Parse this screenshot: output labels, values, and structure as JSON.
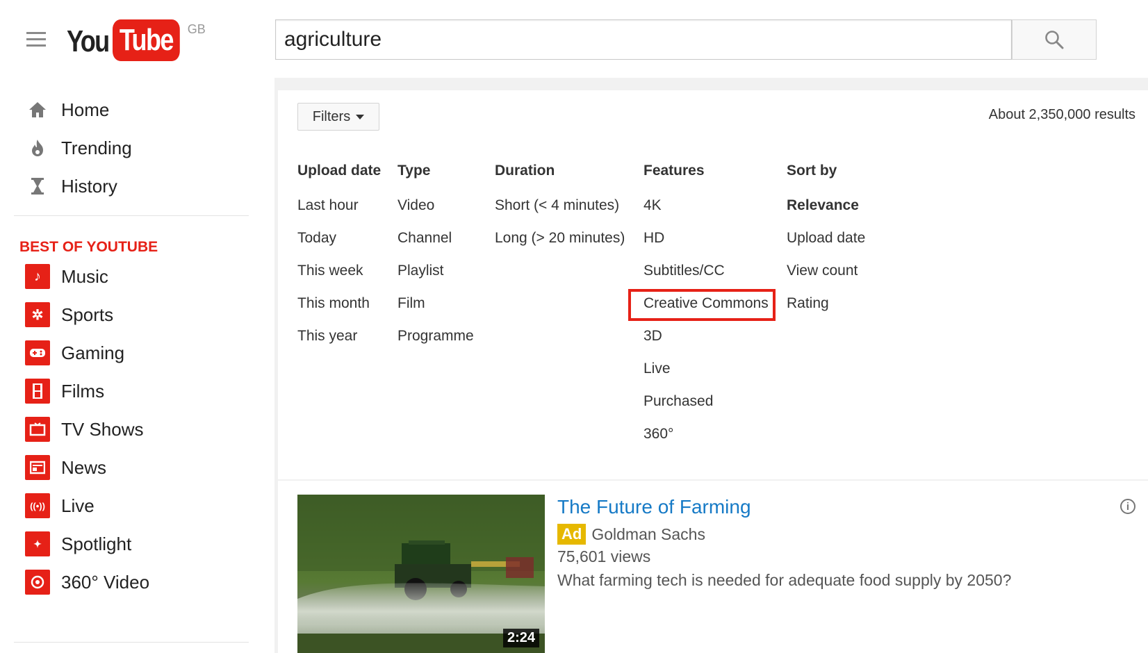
{
  "header": {
    "logo_you": "You",
    "logo_tube": "Tube",
    "logo_region": "GB",
    "search_value": "agriculture"
  },
  "sidebar": {
    "main_items": [
      {
        "label": "Home",
        "icon": "home-icon"
      },
      {
        "label": "Trending",
        "icon": "flame-icon"
      },
      {
        "label": "History",
        "icon": "hourglass-icon"
      }
    ],
    "section_heading": "BEST OF YOUTUBE",
    "best_items": [
      {
        "label": "Music",
        "icon": "music-icon"
      },
      {
        "label": "Sports",
        "icon": "sports-icon"
      },
      {
        "label": "Gaming",
        "icon": "gaming-icon"
      },
      {
        "label": "Films",
        "icon": "films-icon"
      },
      {
        "label": "TV Shows",
        "icon": "tv-icon"
      },
      {
        "label": "News",
        "icon": "news-icon"
      },
      {
        "label": "Live",
        "icon": "live-icon"
      },
      {
        "label": "Spotlight",
        "icon": "spotlight-icon"
      },
      {
        "label": "360° Video",
        "icon": "360-video-icon"
      }
    ]
  },
  "filters": {
    "button_label": "Filters",
    "results_count": "About 2,350,000 results",
    "columns": [
      {
        "heading": "Upload date",
        "options": [
          "Last hour",
          "Today",
          "This week",
          "This month",
          "This year"
        ]
      },
      {
        "heading": "Type",
        "options": [
          "Video",
          "Channel",
          "Playlist",
          "Film",
          "Programme"
        ]
      },
      {
        "heading": "Duration",
        "options": [
          "Short (< 4 minutes)",
          "Long (> 20 minutes)"
        ]
      },
      {
        "heading": "Features",
        "options": [
          "4K",
          "HD",
          "Subtitles/CC",
          "Creative Commons",
          "3D",
          "Live",
          "Purchased",
          "360°"
        ]
      },
      {
        "heading": "Sort by",
        "options": [
          "Relevance",
          "Upload date",
          "View count",
          "Rating"
        ]
      }
    ],
    "highlighted_option": "Creative Commons",
    "highlight_color": "#e62117"
  },
  "result": {
    "title": "The Future of Farming",
    "ad_label": "Ad",
    "channel": "Goldman Sachs",
    "views": "75,601 views",
    "description": "What farming tech is needed for adequate food supply by 2050?",
    "duration": "2:24"
  },
  "colors": {
    "brand_red": "#e62117",
    "link_blue": "#167ac6",
    "ad_yellow": "#e6b800"
  }
}
